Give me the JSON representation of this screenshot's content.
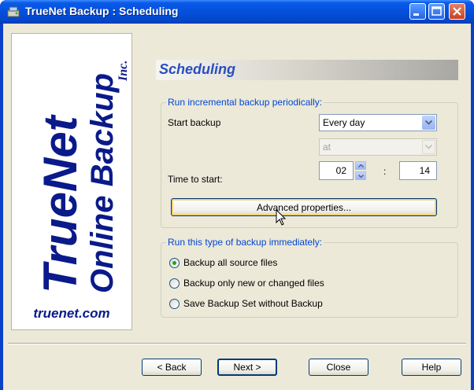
{
  "window": {
    "title": "TrueNet Backup : Scheduling"
  },
  "logo": {
    "line1": "TrueNet",
    "inc": "Inc.",
    "line2": "Online Backup",
    "url": "truenet.com"
  },
  "heading": "Scheduling",
  "incremental": {
    "legend": "Run incremental backup periodically:",
    "start_label": "Start backup",
    "frequency": "Every day",
    "at": "at",
    "time_label": "Time to start:",
    "hour": "02",
    "colon": ":",
    "minute": "14",
    "advanced_button": "Advanced properties..."
  },
  "immediate": {
    "legend": "Run this type of backup immediately:",
    "options": [
      {
        "label": "Backup all source files",
        "selected": true
      },
      {
        "label": "Backup only new or changed files",
        "selected": false
      },
      {
        "label": "Save Backup Set without Backup",
        "selected": false
      }
    ]
  },
  "footer": {
    "back": "< Back",
    "next": "Next >",
    "close": "Close",
    "help": "Help"
  },
  "colors": {
    "title_bar": "#0450dc",
    "face": "#ece9d8",
    "heading_text": "#2a4fbf",
    "legend_text": "#0046d5",
    "logo_text": "#0a1a8a"
  },
  "icons": [
    "app-icon",
    "minimize-icon",
    "maximize-icon",
    "close-icon",
    "dropdown-arrow-icon",
    "spin-up-icon",
    "spin-down-icon",
    "mouse-cursor-icon"
  ]
}
